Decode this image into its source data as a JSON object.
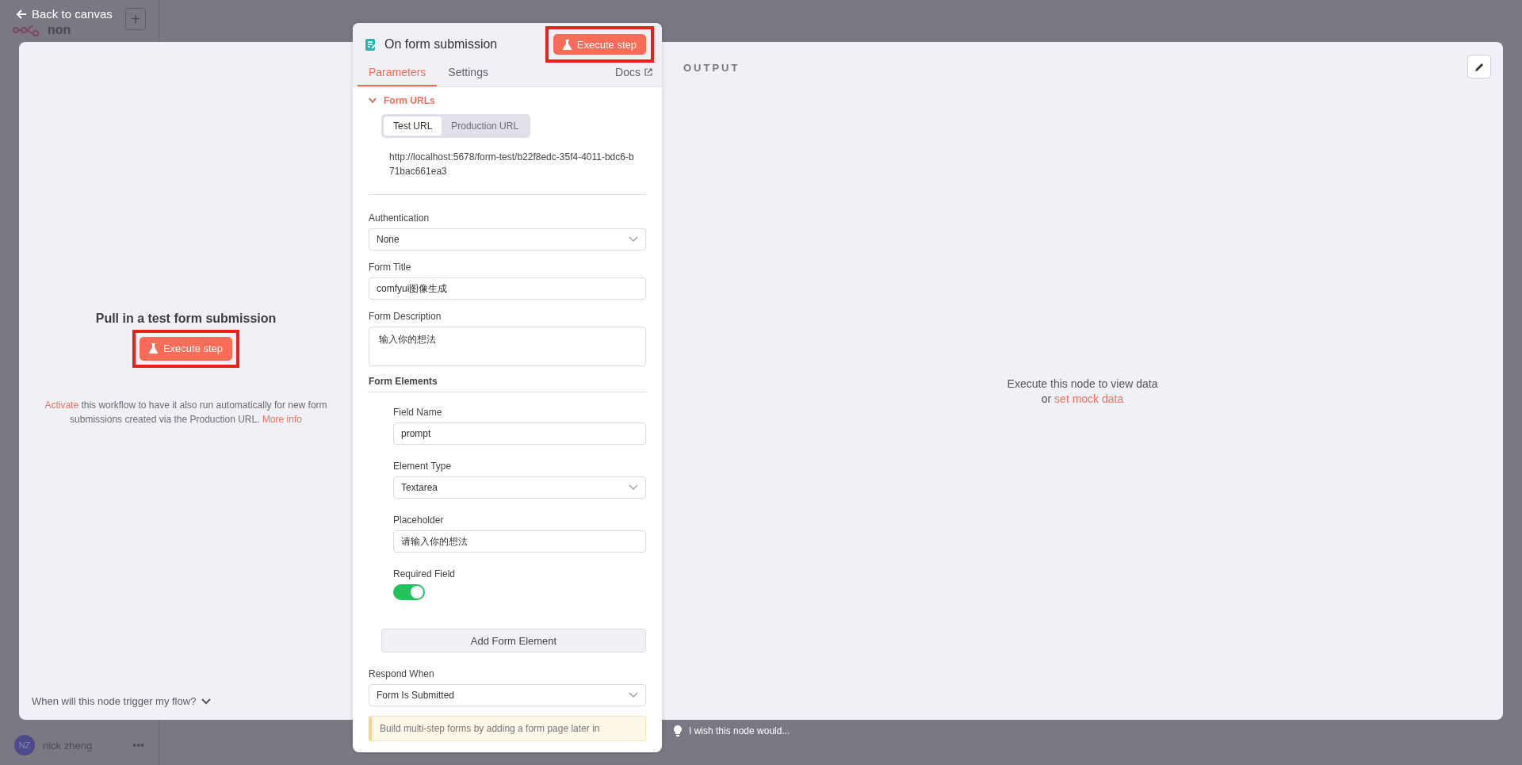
{
  "back_link": "Back to canvas",
  "sidebar": {
    "workflow_name": "non",
    "add": "+",
    "user": {
      "initials": "NZ",
      "name": "nick zheng",
      "menu": "•••"
    }
  },
  "input_pane": {
    "title": "Pull in a test form submission",
    "button": "Execute step",
    "highlighted": true,
    "note": {
      "link": "Activate",
      "text": "this workflow to have it also run automatically for new form submissions created via the Production URL.",
      "more": "More info"
    },
    "trigger_help": "When will this node trigger my flow?"
  },
  "node": {
    "title": "On form submission",
    "execute": "Execute step",
    "highlighted": true,
    "tabs": [
      {
        "label": "Parameters",
        "selected": true
      },
      {
        "label": "Settings",
        "selected": false
      }
    ],
    "docs": "Docs",
    "form_urls": {
      "label": "Form URLs",
      "expanded": true,
      "options": [
        {
          "label": "Test URL",
          "selected": true
        },
        {
          "label": "Production URL",
          "selected": false
        }
      ],
      "url": "http://localhost:5678/form-test/b22f8edc-35f4-4011-bdc6-b71bac661ea3"
    },
    "fields": [
      {
        "kind": "select",
        "label": "Authentication",
        "value": "None"
      },
      {
        "kind": "input",
        "label": "Form Title",
        "value": "comfyui图像生成"
      },
      {
        "kind": "textarea",
        "label": "Form Description",
        "value": "输入你的想法"
      }
    ],
    "form_elements": {
      "label": "Form Elements",
      "items": [
        {
          "kind": "input",
          "label": "Field Name",
          "value": "prompt"
        },
        {
          "kind": "select",
          "label": "Element Type",
          "value": "Textarea"
        },
        {
          "kind": "input",
          "label": "Placeholder",
          "value": "请输入你的想法"
        },
        {
          "kind": "toggle",
          "label": "Required Field",
          "on": true
        }
      ],
      "add_button": "Add Form Element"
    },
    "respond": {
      "kind": "select",
      "label": "Respond When",
      "value": "Form Is Submitted"
    },
    "notice": "Build multi-step forms by adding a form page later in"
  },
  "output_pane": {
    "label": "OUTPUT",
    "empty_text": "Execute this node to view data",
    "or": "or",
    "mock_link": "set mock data"
  },
  "feedback": "I wish this node would..."
}
